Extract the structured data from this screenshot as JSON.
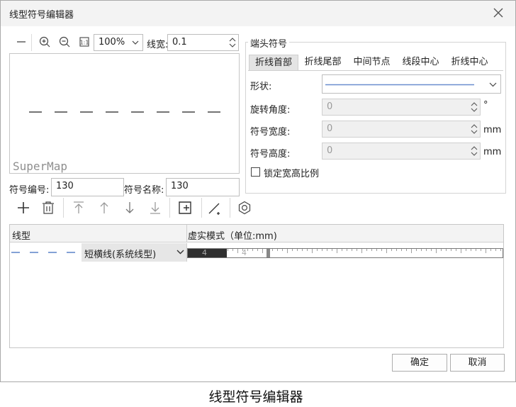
{
  "window": {
    "title": "线型符号编辑器"
  },
  "toolbar": {
    "zoom_value": "100%",
    "line_width_label": "线宽:",
    "line_width_value": "0.1"
  },
  "preview": {
    "watermark": "SuperMap"
  },
  "symbol": {
    "code_label": "符号编号:",
    "code_value": "130",
    "name_label": "符号名称:",
    "name_value": "130"
  },
  "end_symbol": {
    "group_label": "端头符号",
    "tabs": [
      "折线首部",
      "折线尾部",
      "中间节点",
      "线段中心",
      "折线中心"
    ],
    "shape_label": "形状:",
    "rotation_label": "旋转角度:",
    "rotation_value": "0",
    "rotation_unit": "°",
    "width_label": "符号宽度:",
    "width_value": "0",
    "width_unit": "mm",
    "height_label": "符号高度:",
    "height_value": "0",
    "height_unit": "mm",
    "lock_ratio_label": "锁定宽高比例",
    "lock_ratio_checked": false
  },
  "table": {
    "col_linetype": "线型",
    "col_dash_mode": "虚实模式（单位:mm)",
    "rows": [
      {
        "name": "短横线(系统线型)",
        "dash_pattern": [
          4,
          4
        ]
      }
    ]
  },
  "dialog": {
    "ok": "确定",
    "cancel": "取消"
  },
  "figure_caption": "线型符号编辑器",
  "icons": [
    "minus-icon",
    "zoom-in-icon",
    "zoom-out-icon",
    "actual-size-icon",
    "chevron-down-icon",
    "close-icon",
    "add-icon",
    "delete-icon",
    "move-top-icon",
    "move-up-icon",
    "move-down-icon",
    "move-bottom-icon",
    "insert-icon",
    "line-add-icon",
    "hexagon-icon"
  ]
}
